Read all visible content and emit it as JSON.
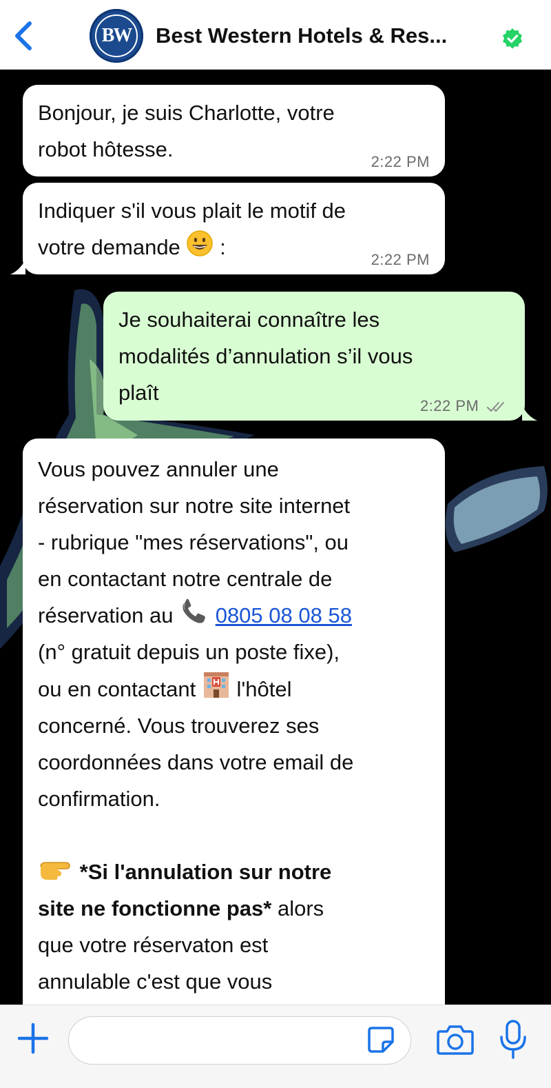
{
  "header": {
    "title": "Best Western Hotels & Res...",
    "avatar_text": "BW",
    "back_icon": "chevron-left-icon",
    "verified_icon": "verified-check-icon",
    "accent_color": "#1a73e8",
    "verified_color": "#25d366"
  },
  "messages": [
    {
      "direction": "incoming",
      "lines": [
        "Bonjour, je suis Charlotte, votre",
        "robot hôtesse."
      ],
      "time": "2:22 PM"
    },
    {
      "direction": "incoming",
      "line1": "Indiquer s'il vous plait le motif de",
      "line2_text": "votre demande",
      "line2_emoji": "grinning-face-icon",
      "line2_suffix": ":",
      "time": "2:22 PM"
    },
    {
      "direction": "outgoing",
      "lines": [
        "Je souhaiterai connaître les",
        "modalités d’annulation s’il vous",
        "plaît"
      ],
      "time": "2:22 PM",
      "status_icon": "double-check-icon"
    },
    {
      "direction": "incoming",
      "lines": [
        "Vous pouvez annuler une",
        "réservation sur notre site internet",
        "- rubrique \"mes réservations\", ou",
        "en contactant notre centrale de"
      ],
      "phone_prefix": "réservation au",
      "phone_icon": "telephone-icon",
      "phone_number": "0805 08 08 58",
      "line_after_phone": "(n° gratuit depuis un poste fixe),",
      "hotel_prefix": "ou en contactant",
      "hotel_icon": "hotel-icon",
      "hotel_suffix": "l'hôtel",
      "lines_end": [
        "concerné. Vous trouverez ses",
        "coordonnées dans votre email de",
        "confirmation."
      ],
      "pointer_icon": "pointing-hand-icon",
      "bold_part1": "*Si l'annulation sur notre",
      "bold_part2": "site ne fonctionne pas*",
      "after_bold": " alors",
      "lines_tail": [
        "que votre réservaton est",
        "annulable c'est que vous"
      ]
    }
  ],
  "composer": {
    "placeholder": "",
    "plus_icon": "plus-icon",
    "sticker_icon": "sticker-icon",
    "camera_icon": "camera-icon",
    "mic_icon": "microphone-icon"
  },
  "colors": {
    "incoming_bubble": "#ffffff",
    "outgoing_bubble": "#d9fdd3",
    "chat_background": "#000000",
    "link": "#1a55d6"
  }
}
